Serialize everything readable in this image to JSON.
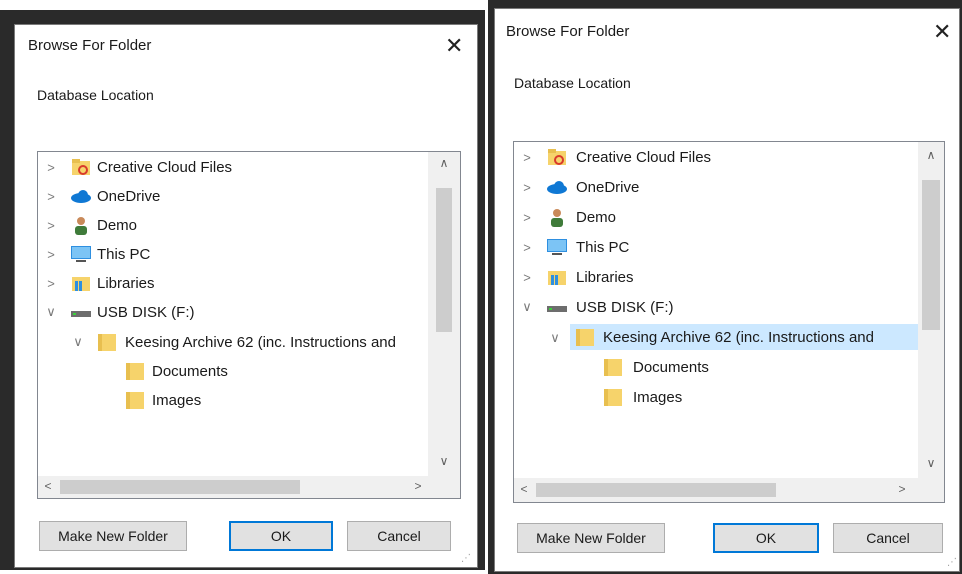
{
  "dialogs": [
    {
      "title": "Browse For Folder",
      "close_glyph": "✕",
      "prompt": "Database Location",
      "tree": [
        {
          "label": "Creative Cloud Files",
          "icon": "creative-cloud-folder-icon",
          "chevron": ">"
        },
        {
          "label": "OneDrive",
          "icon": "onedrive-cloud-icon",
          "chevron": ">"
        },
        {
          "label": "Demo",
          "icon": "user-icon",
          "chevron": ">"
        },
        {
          "label": "This PC",
          "icon": "computer-monitor-icon",
          "chevron": ">"
        },
        {
          "label": "Libraries",
          "icon": "libraries-icon",
          "chevron": ">"
        },
        {
          "label": "USB DISK (F:)",
          "icon": "usb-drive-icon",
          "chevron": "∨"
        },
        {
          "label": "Keesing Archive 62 (inc. Instructions and",
          "icon": "folder-icon",
          "chevron": "∨",
          "selected": false
        },
        {
          "label": "Documents",
          "icon": "folder-icon",
          "chevron": ""
        },
        {
          "label": "Images",
          "icon": "folder-icon",
          "chevron": ""
        }
      ],
      "buttons": {
        "make_new_folder": "Make New Folder",
        "ok": "OK",
        "cancel": "Cancel"
      }
    },
    {
      "title": "Browse For Folder",
      "close_glyph": "✕",
      "prompt": "Database Location",
      "tree": [
        {
          "label": "Creative Cloud Files",
          "icon": "creative-cloud-folder-icon",
          "chevron": ">"
        },
        {
          "label": "OneDrive",
          "icon": "onedrive-cloud-icon",
          "chevron": ">"
        },
        {
          "label": "Demo",
          "icon": "user-icon",
          "chevron": ">"
        },
        {
          "label": "This PC",
          "icon": "computer-monitor-icon",
          "chevron": ">"
        },
        {
          "label": "Libraries",
          "icon": "libraries-icon",
          "chevron": ">"
        },
        {
          "label": "USB DISK (F:)",
          "icon": "usb-drive-icon",
          "chevron": "∨"
        },
        {
          "label": "Keesing Archive 62 (inc. Instructions and",
          "icon": "folder-icon",
          "chevron": "∨",
          "selected": true
        },
        {
          "label": "Documents",
          "icon": "folder-icon",
          "chevron": ""
        },
        {
          "label": "Images",
          "icon": "folder-icon",
          "chevron": ""
        }
      ],
      "buttons": {
        "make_new_folder": "Make New Folder",
        "ok": "OK",
        "cancel": "Cancel"
      }
    }
  ],
  "colors": {
    "selection": "#cce8ff",
    "default_button_border": "#0078d7",
    "folder": "#f6d36b"
  }
}
